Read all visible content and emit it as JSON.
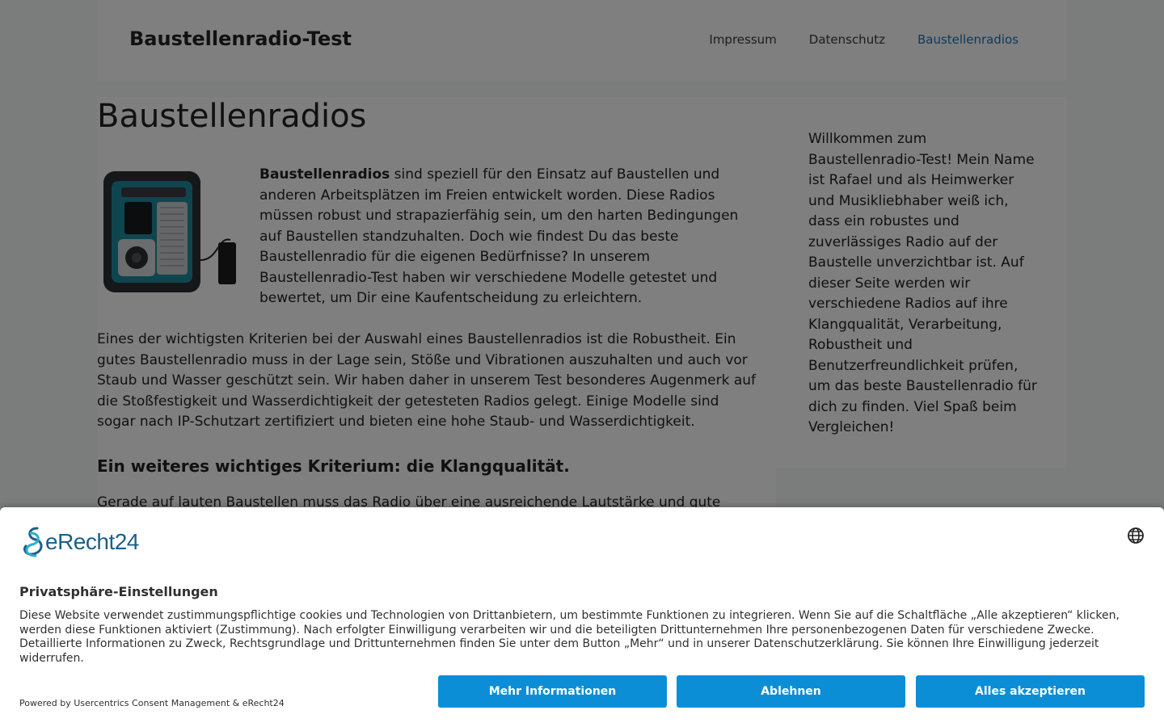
{
  "header": {
    "site_title": "Baustellenradio-Test",
    "nav": [
      {
        "label": "Impressum"
      },
      {
        "label": "Datenschutz"
      },
      {
        "label": "Baustellenradios"
      }
    ]
  },
  "main": {
    "page_title": "Baustellenradios",
    "intro_bold": "Baustellenradios",
    "intro_rest": " sind speziell für den Einsatz auf Baustellen und anderen Arbeitsplätzen im Freien entwickelt worden. Diese Radios müssen robust und strapazierfähig sein, um den harten Bedingungen auf Baustellen standzuhalten. Doch wie findest Du das beste Baustellenradio für die eigenen Bedürfnisse? In unserem Baustellenradio-Test haben wir verschiedene Modelle getestet und bewertet, um Dir eine Kaufentscheidung zu erleichtern.",
    "para2": "Eines der wichtigsten Kriterien bei der Auswahl eines Baustellenradios ist die Robustheit. Ein gutes Baustellenradio muss in der Lage sein, Stöße und Vibrationen auszuhalten und auch vor Staub und Wasser geschützt sein. Wir haben daher in unserem Test besonderes Augenmerk auf die Stoßfestigkeit und Wasserdichtigkeit der getesteten Radios gelegt. Einige Modelle sind sogar nach IP-Schutzart zertifiziert und bieten eine hohe Staub- und Wasserdichtigkeit.",
    "heading2": "Ein weiteres wichtiges Kriterium: die Klangqualität.",
    "para3": "Gerade auf lauten Baustellen muss das Radio über eine ausreichende Lautstärke und gute"
  },
  "sidebar": {
    "text": "Willkommen zum Baustellenradio-Test! Mein Name ist Rafael und als Heimwerker und Musikliebhaber weiß ich, dass ein robustes und zuverlässiges Radio auf der Baustelle unverzichtbar ist. Auf dieser Seite werden wir verschiedene Radios auf ihre Klangqualität, Verarbeitung, Robustheit und Benutzerfreundlichkeit prüfen, um das beste Baustellenradio für dich zu finden. Viel Spaß beim Vergleichen!"
  },
  "consent": {
    "logo_text": "eRecht24",
    "title": "Privatsphäre-Einstellungen",
    "text": "Diese Website verwendet zustimmungspflichtige cookies und Technologien von Drittanbietern, um bestimmte Funktionen zu integrieren. Wenn Sie auf die Schaltfläche „Alle akzeptieren“ klicken, werden diese Funktionen aktiviert (Zustimmung). Nach erfolgter Einwilligung verarbeiten wir und die beteiligten Drittunternehmen Ihre personenbezogenen Daten für verschiedene Zwecke. Detaillierte Informationen zu Zweck, Rechtsgrundlage und Drittunternehmen finden Sie unter dem Button „Mehr“ und in unserer Datenschutzerklärung. Sie können Ihre Einwilligung jederzeit widerrufen.",
    "powered_by": "Powered by Usercentrics Consent Management & eRecht24",
    "buttons": {
      "more": "Mehr Informationen",
      "deny": "Ablehnen",
      "accept": "Alles akzeptieren"
    },
    "button_color": "#0b8ed6"
  },
  "colors": {
    "link_active": "#1e73be",
    "page_bg": "#f7f8f9"
  }
}
